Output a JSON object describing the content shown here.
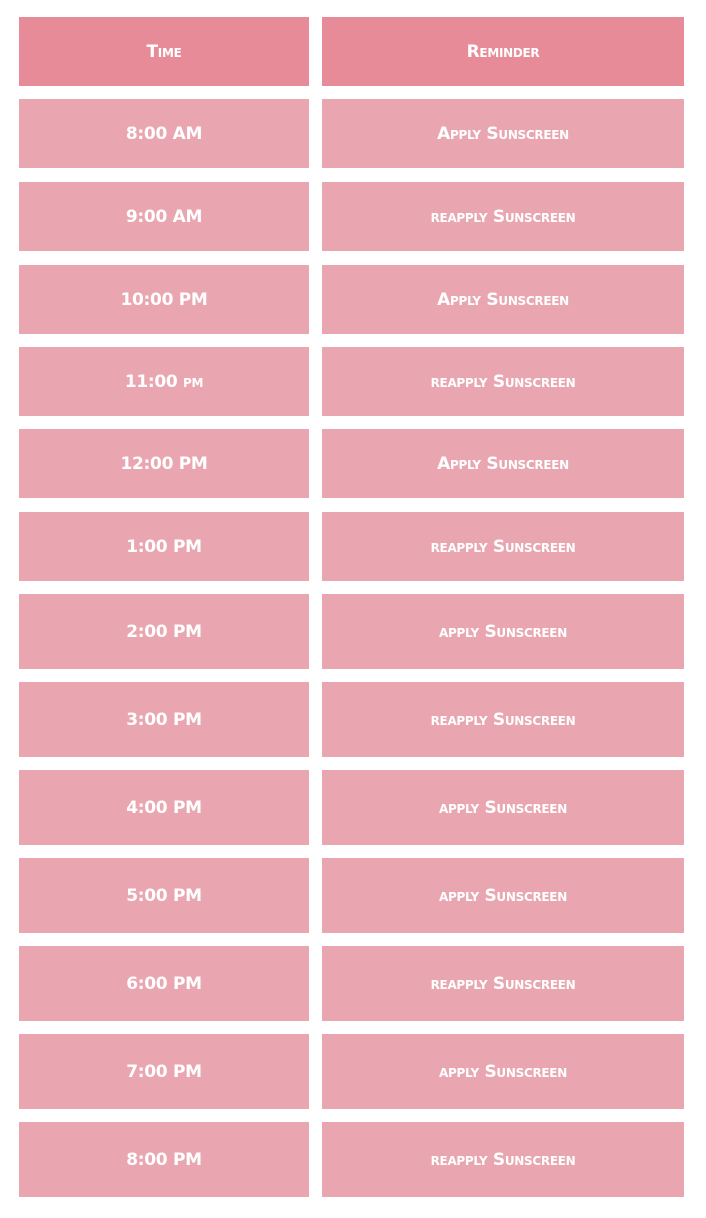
{
  "table": {
    "headers": {
      "time": "Time",
      "reminder": "Reminder"
    },
    "rows": [
      {
        "time": "8:00 AM",
        "reminder": "Apply Sunscreen"
      },
      {
        "time": "9:00 AM",
        "reminder": "reapply Sunscreen"
      },
      {
        "time": "10:00 PM",
        "reminder": "Apply Sunscreen"
      },
      {
        "time": "11:00 pm",
        "reminder": "reapply Sunscreen"
      },
      {
        "time": "12:00 PM",
        "reminder": "Apply Sunscreen"
      },
      {
        "time": "1:00 PM",
        "reminder": "reapply Sunscreen"
      },
      {
        "time": "2:00 PM",
        "reminder": "apply Sunscreen"
      },
      {
        "time": "3:00 PM",
        "reminder": "reapply Sunscreen"
      },
      {
        "time": "4:00 PM",
        "reminder": "apply Sunscreen"
      },
      {
        "time": "5:00 PM",
        "reminder": "apply Sunscreen"
      },
      {
        "time": "6:00 PM",
        "reminder": "reapply Sunscreen"
      },
      {
        "time": "7:00 PM",
        "reminder": "apply Sunscreen"
      },
      {
        "time": "8:00 PM",
        "reminder": "reapply Sunscreen"
      }
    ]
  },
  "colors": {
    "header_bg": "#e88b98",
    "row_bg": "#eaa6b0",
    "text": "#ffffff"
  }
}
